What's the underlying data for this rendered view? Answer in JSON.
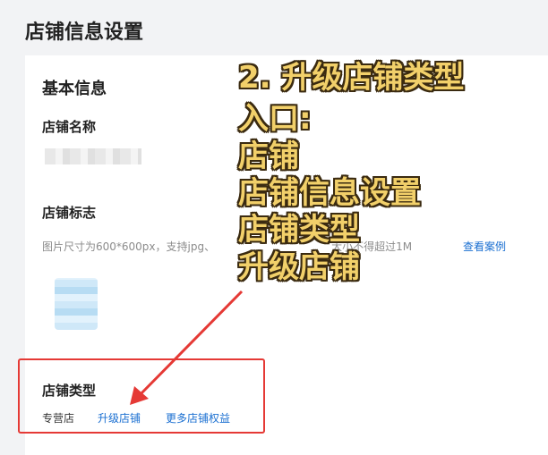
{
  "page": {
    "title": "店铺信息设置"
  },
  "basic": {
    "section_title": "基本信息",
    "name_label": "店铺名称",
    "logo_label": "店铺标志",
    "logo_hint": "图片尺寸为600*600px，支持jpg、",
    "logo_hint_tail": "大小不得超过1M",
    "view_case": "查看案例"
  },
  "store_type": {
    "label": "店铺类型",
    "value": "专营店",
    "upgrade_link": "升级店铺",
    "more_link": "更多店铺权益"
  },
  "overlay": {
    "lines": [
      "2. 升级店铺类型",
      "入口:",
      "店铺",
      "店铺信息设置",
      "店铺类型",
      "升级店铺"
    ],
    "color": "#f2d06a"
  },
  "annotation": {
    "box_color": "#e53935",
    "arrow_color": "#e53935"
  }
}
